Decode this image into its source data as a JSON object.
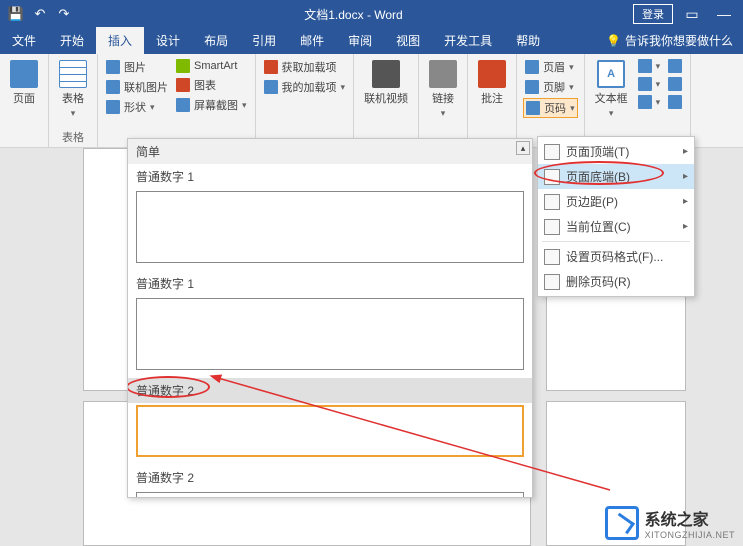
{
  "titlebar": {
    "doc_title": "文档1.docx - Word",
    "login": "登录"
  },
  "tabs": {
    "file": "文件",
    "home": "开始",
    "insert": "插入",
    "design": "设计",
    "layout": "布局",
    "references": "引用",
    "mailings": "邮件",
    "review": "审阅",
    "view": "视图",
    "developer": "开发工具",
    "help": "帮助",
    "tell_me": "告诉我你想要做什么"
  },
  "ribbon": {
    "pages": {
      "label": "页面",
      "group": ""
    },
    "tables": {
      "label": "表格",
      "group": "表格"
    },
    "illustrations": {
      "pic": "图片",
      "online_pic": "联机图片",
      "shapes": "形状",
      "smartart": "SmartArt",
      "chart": "图表",
      "screenshot": "屏幕截图"
    },
    "addins": {
      "get": "获取加载项",
      "my": "我的加载项"
    },
    "media": {
      "online_video": "联机视频"
    },
    "links": {
      "label": "链接"
    },
    "comments": {
      "label": "批注"
    },
    "header_footer": {
      "header": "页眉",
      "footer": "页脚",
      "page_number": "页码"
    },
    "text": {
      "text_box": "文本框"
    }
  },
  "gallery": {
    "header": "简单",
    "items": [
      {
        "label": "普通数字 1"
      },
      {
        "label": "普通数字 1"
      },
      {
        "label": "普通数字 2"
      },
      {
        "label": "普通数字 2"
      }
    ]
  },
  "page_number_menu": {
    "top": "页面顶端(T)",
    "bottom": "页面底端(B)",
    "margins": "页边距(P)",
    "current": "当前位置(C)",
    "format": "设置页码格式(F)...",
    "remove": "删除页码(R)"
  },
  "watermark": {
    "title": "系统之家",
    "sub": "XITONGZHIJIA.NET"
  }
}
